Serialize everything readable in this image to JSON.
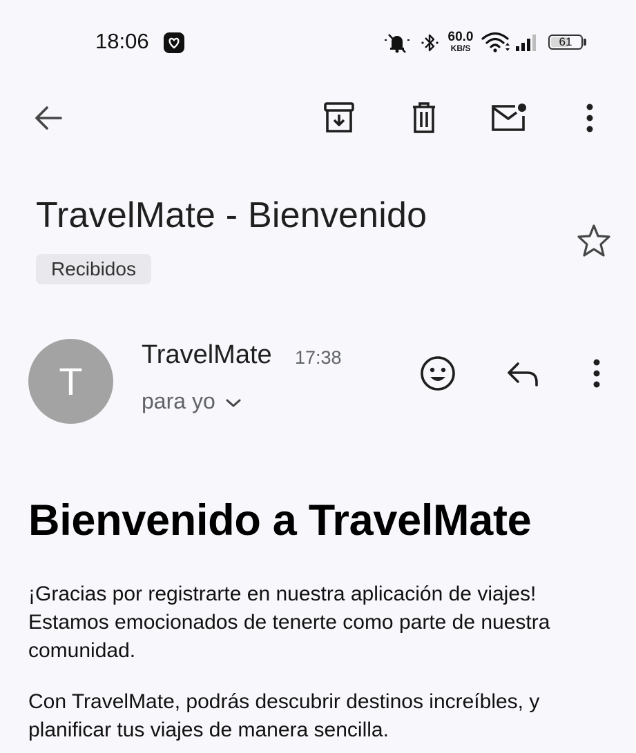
{
  "status_bar": {
    "time": "18:06",
    "net_speed_value": "60.0",
    "net_speed_unit": "KB/S",
    "battery_level": "61",
    "icons": [
      "app-notification-icon",
      "mute-icon",
      "bluetooth-icon",
      "wifi-icon",
      "signal-icon",
      "battery-icon"
    ]
  },
  "toolbar": {
    "icons": [
      "back-arrow-icon",
      "archive-icon",
      "trash-icon",
      "mark-unread-icon",
      "more-vert-icon"
    ]
  },
  "email": {
    "subject": "TravelMate - Bienvenido",
    "label": "Recibidos",
    "sender": {
      "initial": "T",
      "name": "TravelMate",
      "time": "17:38",
      "recipient": "para yo"
    },
    "body": {
      "heading": "Bienvenido a TravelMate",
      "paragraphs": [
        "¡Gracias por registrarte en nuestra aplicación de viajes! Estamos emocionados de tenerte como parte de nuestra comunidad.",
        "Con TravelMate, podrás descubrir destinos increíbles, y planificar tus viajes de manera sencilla."
      ]
    }
  },
  "colors": {
    "background": "#f8f7fc",
    "avatar": "#a3a3a3",
    "chip": "#e9e8ec",
    "icon": "#444746"
  }
}
